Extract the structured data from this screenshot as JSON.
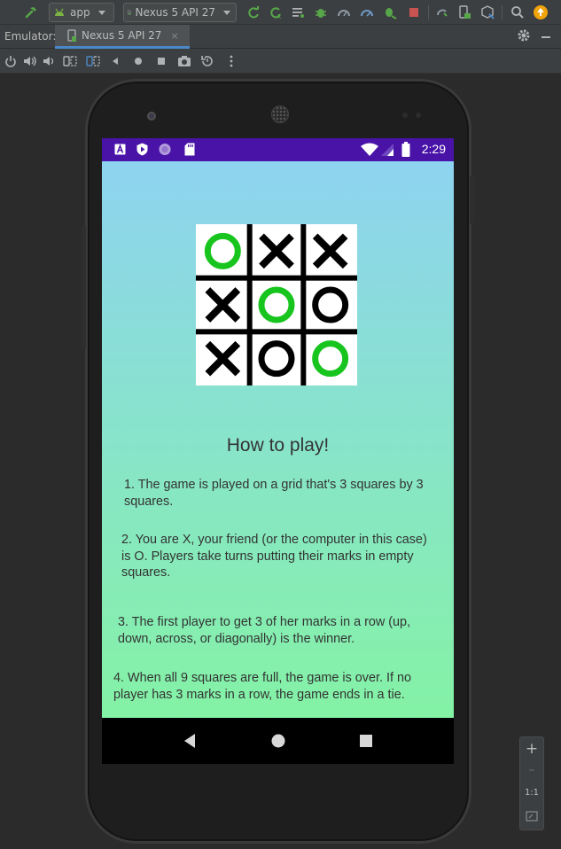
{
  "ide": {
    "run_config": "app",
    "device": "Nexus 5 API 27"
  },
  "emulator_bar": {
    "label": "Emulator:",
    "tab_title": "Nexus 5 API 27",
    "tab_close": "×"
  },
  "phone": {
    "status_bar": {
      "time": "2:29",
      "color": "#4a13a8"
    },
    "board": {
      "cells": [
        "O",
        "X",
        "X",
        "X",
        "O",
        "O",
        "X",
        "O",
        "O"
      ],
      "highlighted_o_color": "#18c41e"
    },
    "content": {
      "title": "How to play!",
      "rules": [
        "1. The game is played on a grid that's 3 squares by 3 squares.",
        "2. You are X, your friend (or the computer in this case) is O. Players take turns putting their marks in empty squares.",
        "3. The first player to get 3 of her marks in a row (up, down, across, or diagonally) is the winner.",
        "4. When all 9 squares are full, the game is over. If no player has 3 marks in a row, the game ends in a tie."
      ]
    }
  },
  "zoom": {
    "zoom_in": "+",
    "zoom_out": "–",
    "actual_size": "1:1"
  }
}
